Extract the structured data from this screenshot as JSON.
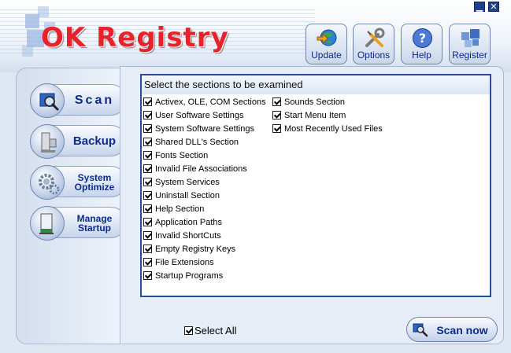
{
  "app": {
    "title": "OK Registry"
  },
  "window_controls": {
    "minimize": "▁",
    "close": "✕"
  },
  "toolbar": [
    {
      "label": "Update",
      "icon": "globe-arrow-icon"
    },
    {
      "label": "Options",
      "icon": "wrench-screwdriver-icon"
    },
    {
      "label": "Help",
      "icon": "help-question-icon"
    },
    {
      "label": "Register",
      "icon": "register-blocks-icon"
    }
  ],
  "nav": [
    {
      "label": "Scan",
      "icon": "magnifier-icon"
    },
    {
      "label": "Backup",
      "icon": "computer-disk-icon"
    },
    {
      "label": "System Optimize",
      "icon": "gear-icon"
    },
    {
      "label": "Manage Startup",
      "icon": "window-startup-icon"
    }
  ],
  "sections": {
    "heading": "Select the sections to be examined",
    "col1": [
      {
        "label": "Activex, OLE, COM Sections",
        "checked": true
      },
      {
        "label": "User Software Settings",
        "checked": true
      },
      {
        "label": "System Software Settings",
        "checked": true
      },
      {
        "label": "Shared DLL's Section",
        "checked": true
      },
      {
        "label": "Fonts Section",
        "checked": true
      },
      {
        "label": "Invalid File Associations",
        "checked": true
      },
      {
        "label": "System Services",
        "checked": true
      },
      {
        "label": "Uninstall Section",
        "checked": true
      },
      {
        "label": "Help Section",
        "checked": true
      },
      {
        "label": "Application Paths",
        "checked": true
      },
      {
        "label": "Invalid ShortCuts",
        "checked": true
      },
      {
        "label": "Empty Registry Keys",
        "checked": true
      },
      {
        "label": "File Extensions",
        "checked": true
      },
      {
        "label": "Startup Programs",
        "checked": true
      }
    ],
    "col2": [
      {
        "label": "Sounds Section",
        "checked": true
      },
      {
        "label": "Start Menu Item",
        "checked": true
      },
      {
        "label": "Most Recently Used Files",
        "checked": true
      }
    ]
  },
  "footer": {
    "select_all_label": "Select All",
    "select_all_checked": true,
    "scan_now_label": "Scan now"
  },
  "colors": {
    "accent": "#0b2c8c",
    "logo_red": "#e8222a",
    "border_blue": "#2b4e9b"
  }
}
